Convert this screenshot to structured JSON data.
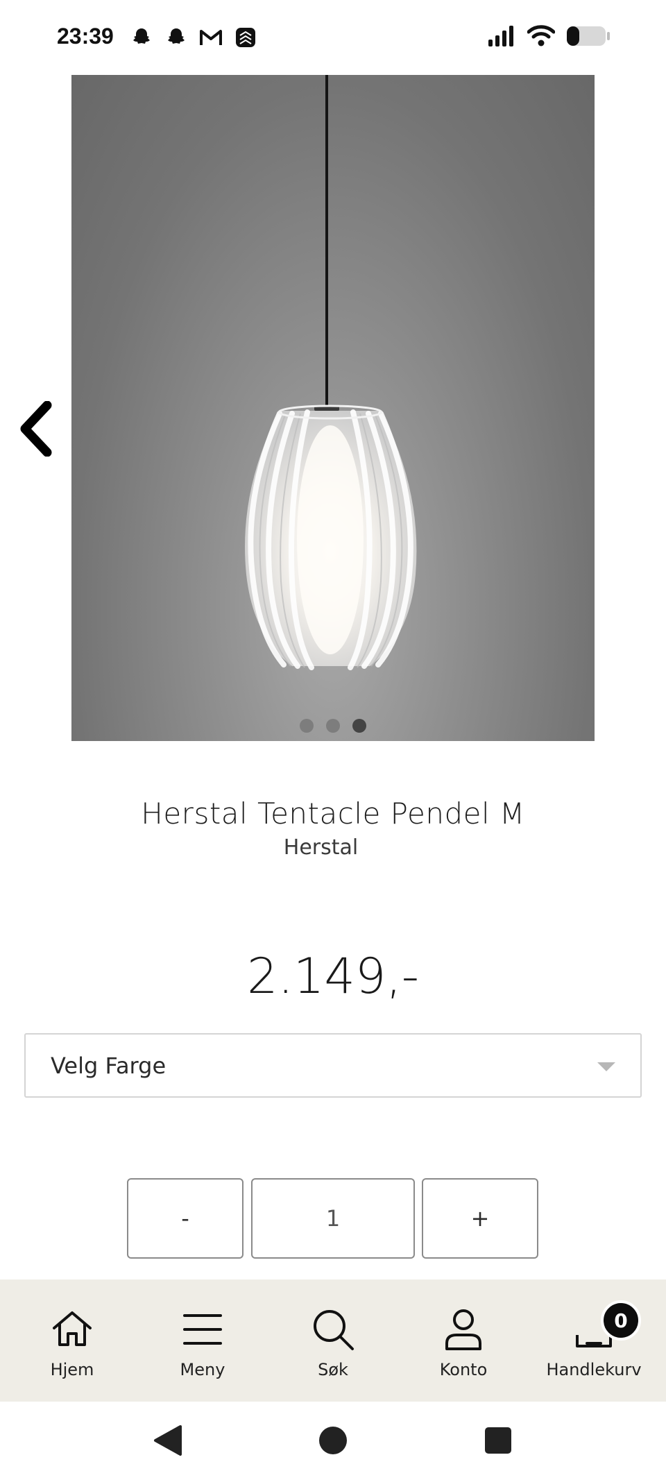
{
  "status_bar": {
    "time": "23:39",
    "left_icons": [
      "snapchat-icon",
      "snapchat-icon",
      "gmail-icon",
      "app-icon"
    ],
    "right_icons": [
      "signal-icon",
      "wifi-icon",
      "battery-icon"
    ]
  },
  "gallery": {
    "image_alt": "",
    "slides_total": 3,
    "active_slide": 3
  },
  "product": {
    "title": "Herstal Tentacle Pendel M",
    "brand": "Herstal",
    "price": "2.149,-"
  },
  "color_select": {
    "label": "Velg Farge"
  },
  "quantity": {
    "minus_label": "-",
    "value": "1",
    "plus_label": "+"
  },
  "bottom_nav": {
    "items": [
      {
        "label": "Hjem",
        "icon": "home-icon"
      },
      {
        "label": "Meny",
        "icon": "menu-icon"
      },
      {
        "label": "Søk",
        "icon": "search-icon"
      },
      {
        "label": "Konto",
        "icon": "user-icon"
      },
      {
        "label": "Handlekurv",
        "icon": "cart-icon"
      }
    ],
    "cart_count": "0"
  },
  "colors": {
    "nav_background": "#efede6",
    "badge": "#0d0d0d",
    "text": "#1b1b1b"
  }
}
